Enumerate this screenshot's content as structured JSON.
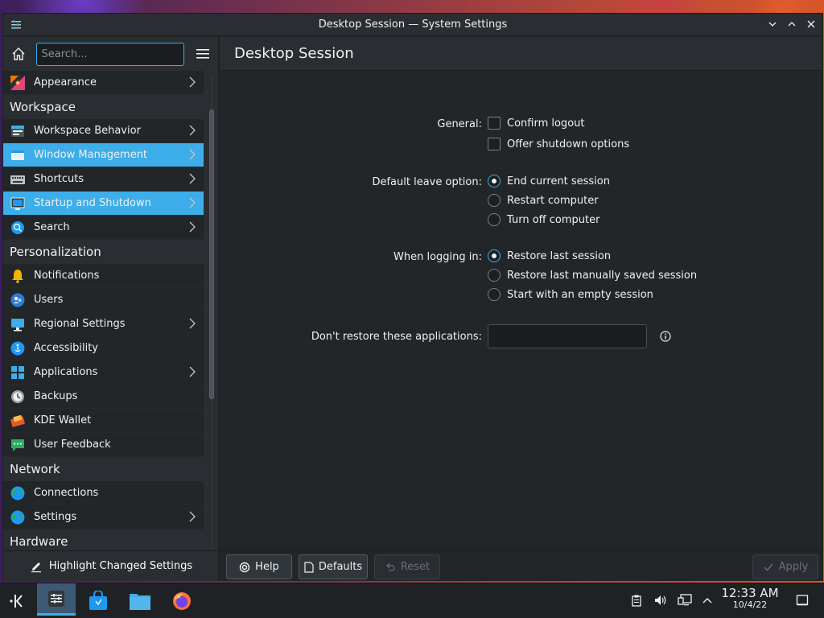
{
  "window": {
    "title": "Desktop Session — System Settings"
  },
  "sidebar": {
    "search_placeholder": "Search...",
    "items": [
      {
        "label": "Appearance",
        "type": "item",
        "chevron": true,
        "icon": "appearance-icon",
        "color": "#e0457b"
      },
      {
        "label": "Workspace",
        "type": "category"
      },
      {
        "label": "Workspace Behavior",
        "type": "item",
        "chevron": true,
        "icon": "workspace-behavior-icon",
        "color": "#3daee9"
      },
      {
        "label": "Window Management",
        "type": "item",
        "chevron": true,
        "icon": "window-management-icon",
        "selected": true,
        "color": "#eff0f1"
      },
      {
        "label": "Shortcuts",
        "type": "item",
        "chevron": true,
        "icon": "keyboard-icon",
        "color": "#bdc3c7"
      },
      {
        "label": "Startup and Shutdown",
        "type": "item",
        "chevron": true,
        "icon": "startup-icon",
        "selected": true,
        "color": "#31363b"
      },
      {
        "label": "Search",
        "type": "item",
        "chevron": true,
        "icon": "search-icon",
        "color": "#1d99f3"
      },
      {
        "label": "Personalization",
        "type": "category"
      },
      {
        "label": "Notifications",
        "type": "item",
        "chevron": false,
        "icon": "bell-icon",
        "color": "#f4b400"
      },
      {
        "label": "Users",
        "type": "item",
        "chevron": false,
        "icon": "users-icon",
        "color": "#2d7dd2"
      },
      {
        "label": "Regional Settings",
        "type": "item",
        "chevron": true,
        "icon": "regional-icon",
        "color": "#3daee9"
      },
      {
        "label": "Accessibility",
        "type": "item",
        "chevron": false,
        "icon": "accessibility-icon",
        "color": "#1d99f3"
      },
      {
        "label": "Applications",
        "type": "item",
        "chevron": true,
        "icon": "applications-icon",
        "color": "#3daee9"
      },
      {
        "label": "Backups",
        "type": "item",
        "chevron": false,
        "icon": "backups-icon",
        "color": "#9ea3a8"
      },
      {
        "label": "KDE Wallet",
        "type": "item",
        "chevron": false,
        "icon": "wallet-icon",
        "color": "#e05a2b"
      },
      {
        "label": "User Feedback",
        "type": "item",
        "chevron": false,
        "icon": "feedback-icon",
        "color": "#27ae60"
      },
      {
        "label": "Network",
        "type": "category"
      },
      {
        "label": "Connections",
        "type": "item",
        "chevron": false,
        "icon": "globe-icon",
        "color": "#27ae60"
      },
      {
        "label": "Settings",
        "type": "item",
        "chevron": true,
        "icon": "globe-icon",
        "color": "#27ae60"
      },
      {
        "label": "Hardware",
        "type": "category"
      }
    ],
    "footer_label": "Highlight Changed Settings"
  },
  "content": {
    "title": "Desktop Session",
    "general_label": "General:",
    "confirm_logout": "Confirm logout",
    "offer_shutdown": "Offer shutdown options",
    "leave_label": "Default leave option:",
    "leave_options": [
      "End current session",
      "Restart computer",
      "Turn off computer"
    ],
    "login_label": "When logging in:",
    "login_options": [
      "Restore last session",
      "Restore last manually saved session",
      "Start with an empty session"
    ],
    "restore_label": "Don't restore these applications:",
    "restore_value": ""
  },
  "footer": {
    "help": "Help",
    "defaults": "Defaults",
    "reset": "Reset",
    "apply": "Apply"
  },
  "taskbar": {
    "time": "12:33 AM",
    "date": "10/4/22"
  },
  "colors": {
    "accent": "#3daee9",
    "window_bg": "#232629",
    "panel_bg": "#2a2e32"
  }
}
